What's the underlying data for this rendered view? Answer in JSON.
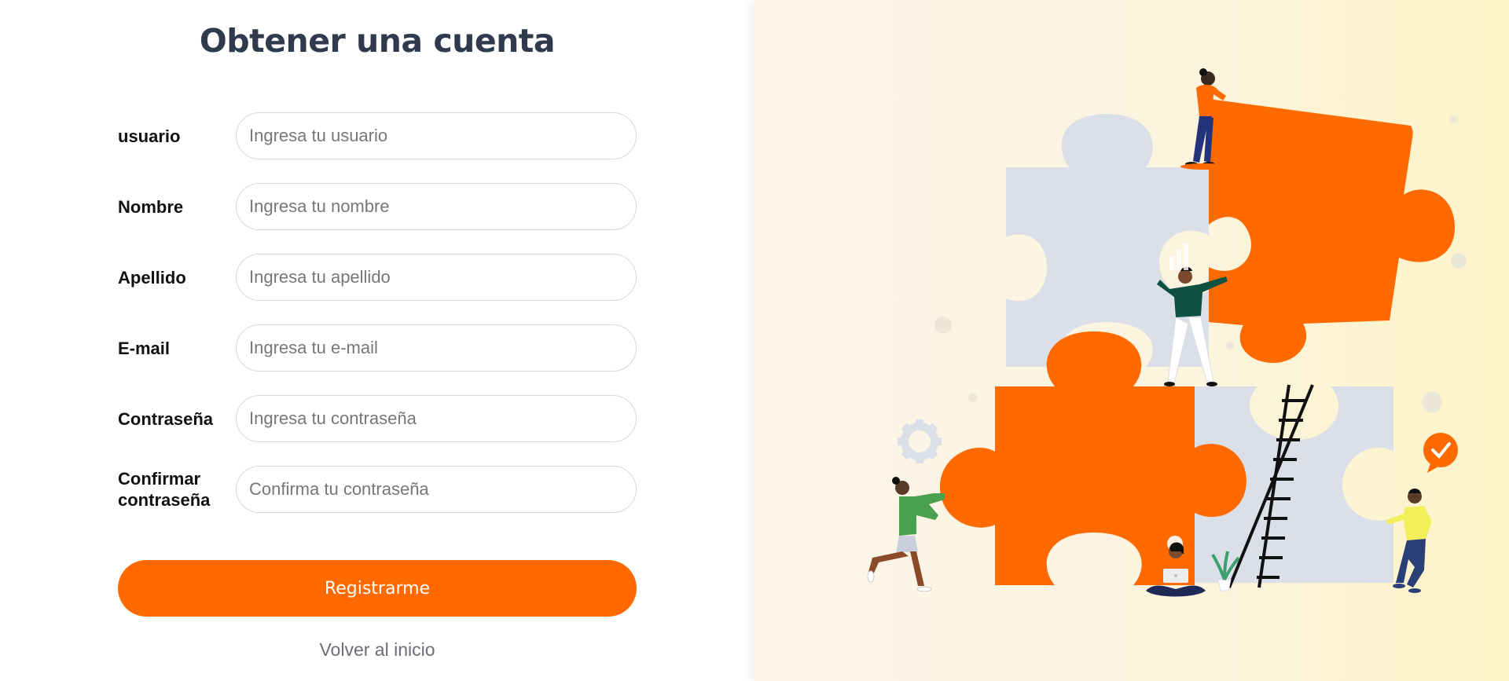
{
  "page": {
    "title": "Obtener una cuenta"
  },
  "form": {
    "fields": [
      {
        "label": "usuario",
        "placeholder": "Ingresa tu usuario",
        "value": ""
      },
      {
        "label": "Nombre",
        "placeholder": "Ingresa tu nombre",
        "value": ""
      },
      {
        "label": "Apellido",
        "placeholder": "Ingresa tu apellido",
        "value": ""
      },
      {
        "label": "E-mail",
        "placeholder": "Ingresa tu e-mail",
        "value": ""
      },
      {
        "label": "Contraseña",
        "placeholder": "Ingresa tu contraseña",
        "value": ""
      },
      {
        "label": "Confirmar contraseña",
        "placeholder": "Confirma tu contraseña",
        "value": ""
      }
    ],
    "submit_label": "Registrarme",
    "back_link": "Volver al inicio"
  },
  "colors": {
    "accent": "#ff6a00",
    "title_text": "#2f3a4d",
    "puzzle_gray": "#dadfe8",
    "background_right": "#fcf5e2"
  },
  "illustration": {
    "icon": "puzzle-teamwork-illustration",
    "elements": [
      "puzzle-piece-icon",
      "gear-icon",
      "checkmark-bubble-icon",
      "ladder-icon",
      "potted-plant-icon",
      "laptop-icon"
    ]
  }
}
